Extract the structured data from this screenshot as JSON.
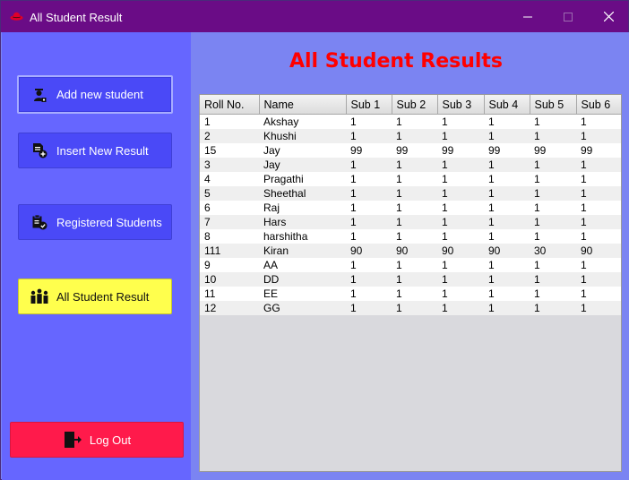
{
  "window": {
    "title": "All Student Result"
  },
  "sidebar": {
    "items": [
      {
        "label": "Add new student",
        "icon": "student-icon"
      },
      {
        "label": "Insert New Result",
        "icon": "document-add-icon"
      },
      {
        "label": "Registered Students",
        "icon": "clipboard-check-icon"
      },
      {
        "label": "All Student Result",
        "icon": "group-icon"
      }
    ],
    "logout": {
      "label": "Log Out",
      "icon": "exit-door-icon"
    }
  },
  "main": {
    "title": "All Student Results",
    "columns": [
      "Roll No.",
      "Name",
      "Sub 1",
      "Sub 2",
      "Sub 3",
      "Sub 4",
      "Sub 5",
      "Sub 6"
    ],
    "rows": [
      [
        "1",
        "Akshay",
        "1",
        "1",
        "1",
        "1",
        "1",
        "1"
      ],
      [
        "2",
        "Khushi",
        "1",
        "1",
        "1",
        "1",
        "1",
        "1"
      ],
      [
        "15",
        "Jay",
        "99",
        "99",
        "99",
        "99",
        "99",
        "99"
      ],
      [
        "3",
        "Jay",
        "1",
        "1",
        "1",
        "1",
        "1",
        "1"
      ],
      [
        "4",
        "Pragathi",
        "1",
        "1",
        "1",
        "1",
        "1",
        "1"
      ],
      [
        "5",
        "Sheethal",
        "1",
        "1",
        "1",
        "1",
        "1",
        "1"
      ],
      [
        "6",
        "Raj",
        "1",
        "1",
        "1",
        "1",
        "1",
        "1"
      ],
      [
        "7",
        "Hars",
        "1",
        "1",
        "1",
        "1",
        "1",
        "1"
      ],
      [
        "8",
        "harshitha",
        "1",
        "1",
        "1",
        "1",
        "1",
        "1"
      ],
      [
        "111",
        "Kiran",
        "90",
        "90",
        "90",
        "90",
        "30",
        "90"
      ],
      [
        "9",
        "AA",
        "1",
        "1",
        "1",
        "1",
        "1",
        "1"
      ],
      [
        "10",
        "DD",
        "1",
        "1",
        "1",
        "1",
        "1",
        "1"
      ],
      [
        "11",
        "EE",
        "1",
        "1",
        "1",
        "1",
        "1",
        "1"
      ],
      [
        "12",
        "GG",
        "1",
        "1",
        "1",
        "1",
        "1",
        "1"
      ]
    ]
  },
  "colors": {
    "titlebar": "#6a0c86",
    "sidebar": "#6666ff",
    "main_bg": "#7b84f2",
    "nav_button": "#4a49f7",
    "active_button": "#ffff4d",
    "logout_button": "#ff1a4b",
    "title_text": "#ff0000"
  }
}
